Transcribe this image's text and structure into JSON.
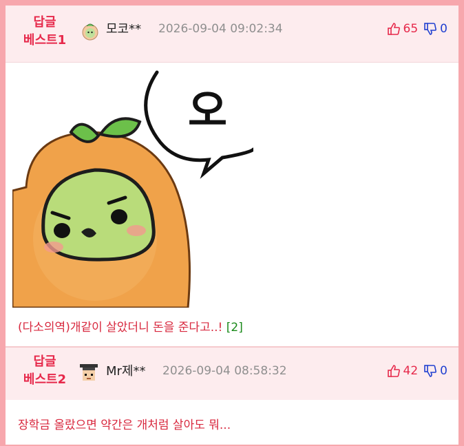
{
  "comments": [
    {
      "best_line1": "답글",
      "best_line2": "베스트1",
      "nickname": "모코**",
      "timestamp": "2026-09-04 09:02:34",
      "upvotes": "65",
      "downvotes": "0",
      "text": "(다소의역)개같이 살았더니 돈을 준다고..!",
      "reply_count": "[2]",
      "emoticon_text": "오",
      "avatar_icon": "mandarin-character-icon"
    },
    {
      "best_line1": "답글",
      "best_line2": "베스트2",
      "nickname": "Mr제**",
      "timestamp": "2026-09-04 08:58:32",
      "upvotes": "42",
      "downvotes": "0",
      "text": "장학금 올랐으면 약간은 개처럼 살아도 뭐...",
      "avatar_icon": "graduate-character-icon"
    }
  ],
  "colors": {
    "frame": "#f7a7ad",
    "header_bg": "#fdecee",
    "accent_red": "#e6284a",
    "accent_blue": "#1f3fd0",
    "reply_green": "#1a8a1a"
  }
}
